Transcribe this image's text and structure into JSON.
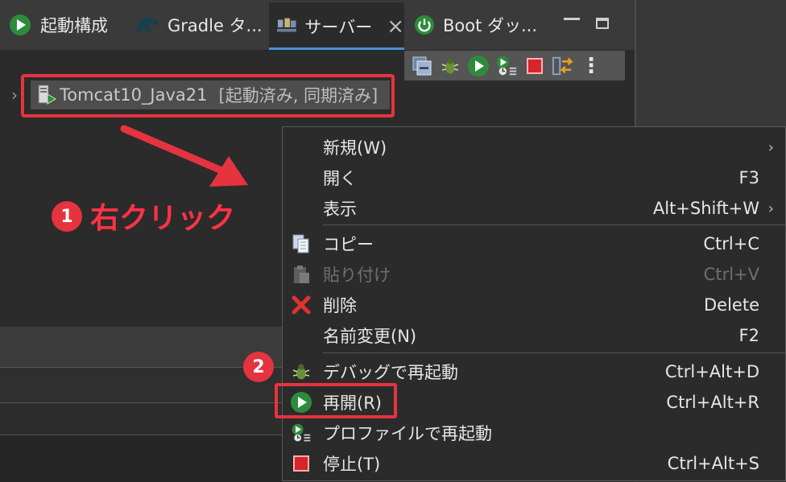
{
  "tabs": [
    {
      "label": "起動構成",
      "icon": "play-icon",
      "active": false
    },
    {
      "label": "Gradle タ...",
      "icon": "gradle-elephant-icon",
      "active": false
    },
    {
      "label": "サーバー",
      "icon": "servers-icon",
      "active": true
    },
    {
      "label": "Boot ダッ...",
      "icon": "power-icon",
      "active": false
    }
  ],
  "server": {
    "name": "Tomcat10_Java21",
    "state": "[起動済み, 同期済み]"
  },
  "annotations": {
    "step1_number": "1",
    "step1_text": "右クリック",
    "step2_number": "2"
  },
  "context_menu": {
    "items": [
      {
        "label": "新規(W)",
        "shortcut": "",
        "submenu": true,
        "enabled": true,
        "icon": ""
      },
      {
        "label": "開く",
        "shortcut": "F3",
        "submenu": false,
        "enabled": true,
        "icon": ""
      },
      {
        "label": "表示",
        "shortcut": "Alt+Shift+W",
        "submenu": true,
        "enabled": true,
        "icon": ""
      },
      {
        "label": "コピー",
        "shortcut": "Ctrl+C",
        "submenu": false,
        "enabled": true,
        "icon": "copy-icon"
      },
      {
        "label": "貼り付け",
        "shortcut": "Ctrl+V",
        "submenu": false,
        "enabled": false,
        "icon": "paste-icon"
      },
      {
        "label": "削除",
        "shortcut": "Delete",
        "submenu": false,
        "enabled": true,
        "icon": "delete-icon"
      },
      {
        "label": "名前変更(N)",
        "shortcut": "F2",
        "submenu": false,
        "enabled": true,
        "icon": ""
      },
      {
        "label": "デバッグで再起動",
        "shortcut": "Ctrl+Alt+D",
        "submenu": false,
        "enabled": true,
        "icon": "debug-icon"
      },
      {
        "label": "再開(R)",
        "shortcut": "Ctrl+Alt+R",
        "submenu": false,
        "enabled": true,
        "icon": "play-icon"
      },
      {
        "label": "プロファイルで再起動",
        "shortcut": "",
        "submenu": false,
        "enabled": true,
        "icon": "profile-icon"
      },
      {
        "label": "停止(T)",
        "shortcut": "Ctrl+Alt+S",
        "submenu": false,
        "enabled": true,
        "icon": "stop-icon"
      }
    ]
  },
  "colors": {
    "highlight": "#e53340",
    "accent": "#4a8fd9"
  }
}
